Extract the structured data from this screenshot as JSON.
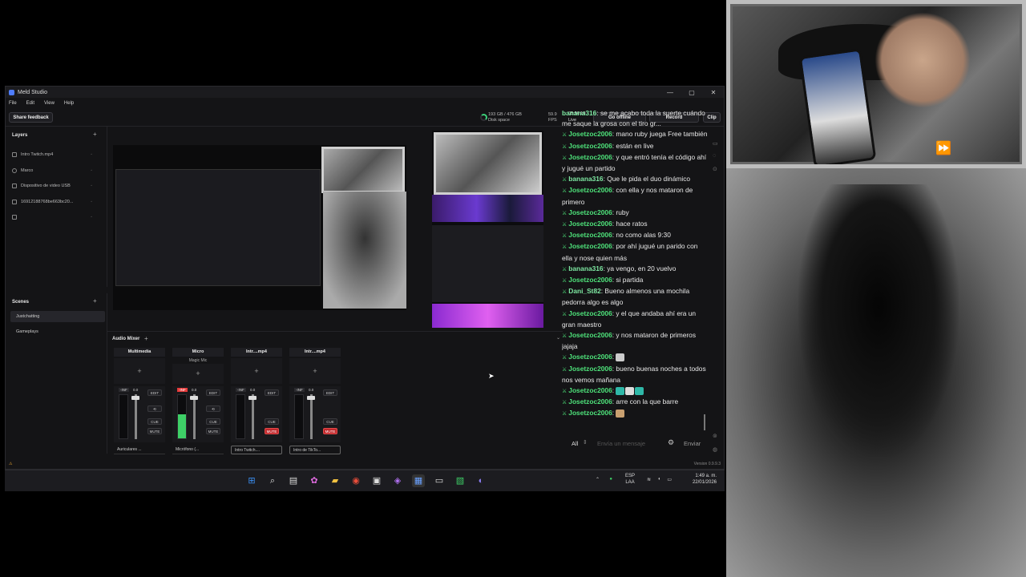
{
  "app": {
    "title": "Meld Studio",
    "menu": [
      "File",
      "Edit",
      "View",
      "Help"
    ],
    "share_feedback": "Share feedback",
    "disk": {
      "line1": "193 GB / 476 GB",
      "line2": "Disk space"
    },
    "fps": {
      "value": "59.9",
      "label": "FPS"
    },
    "live": {
      "time": "05:56:10",
      "label": "Live"
    },
    "go_offline": "Go offline",
    "record": "Record",
    "clip": "Clip",
    "window_controls": [
      "—",
      "▢",
      "✕"
    ]
  },
  "layers": {
    "title": "Layers",
    "items": [
      {
        "label": "Intro Twitch.mp4"
      },
      {
        "label": "Marco"
      },
      {
        "label": "Dispositivo de video USB"
      },
      {
        "label": "16912188768be663bc20..."
      },
      {
        "label": ""
      }
    ]
  },
  "scenes": {
    "title": "Scenes",
    "items": [
      {
        "label": "Justchatting",
        "active": true
      },
      {
        "label": "Gameplays",
        "active": false
      }
    ]
  },
  "mixer": {
    "title": "Audio Mixer",
    "strips": [
      {
        "name": "Multimedia",
        "sub": "",
        "db": "-INF",
        "db2": "0.0",
        "level": 0.0,
        "device": "Auriculares ...",
        "mute_red": false
      },
      {
        "name": "Micro",
        "sub": "Magic Mic",
        "db": "-INF",
        "db2": "0.0",
        "level": 0.55,
        "device": "Micrófono (...",
        "mute_red": false
      },
      {
        "name": "Intr....mp4",
        "sub": "",
        "db": "-INF",
        "db2": "0.0",
        "level": 0.0,
        "device": "Intro Twitch....",
        "mute_red": true
      },
      {
        "name": "Intr....mp4",
        "sub": "",
        "db": "-INF",
        "db2": "0.0",
        "level": 0.0,
        "device": "Intro de TikTo...",
        "mute_red": true
      }
    ],
    "buttons": {
      "edit": "EDIT",
      "cue": "CUE",
      "mute": "MUTE"
    }
  },
  "chat": {
    "messages": [
      {
        "user": "banana316",
        "text": ": se me acabo toda la suerte cuándo me saque la grosa con el tiro gr..."
      },
      {
        "user": "Josetzoc2006",
        "text": ": mano ruby juega Free también"
      },
      {
        "user": "Josetzoc2006",
        "text": ": están en live"
      },
      {
        "user": "Josetzoc2006",
        "text": ": y que entró tenía el código ahí y jugué un partido"
      },
      {
        "user": "banana316",
        "text": ": Que le pida el duo dinámico"
      },
      {
        "user": "Josetzoc2006",
        "text": ": con ella y nos mataron de primero"
      },
      {
        "user": "Josetzoc2006",
        "text": ": ruby"
      },
      {
        "user": "Josetzoc2006",
        "text": ": hace ratos"
      },
      {
        "user": "Josetzoc2006",
        "text": ": no como alas 9:30"
      },
      {
        "user": "Josetzoc2006",
        "text": ": por ahí jugué un parido con ella y nose quien más"
      },
      {
        "user": "banana316",
        "text": ": ya vengo, en 20 vuelvo"
      },
      {
        "user": "Josetzoc2006",
        "text": ": si partida"
      },
      {
        "user": "Dani_St82",
        "text": ": Bueno almenos una mochila pedorra algo es algo"
      },
      {
        "user": "Josetzoc2006",
        "text": ": y el que andaba ahí era un gran maestro"
      },
      {
        "user": "Josetzoc2006",
        "text": ": y nos mataron de primeros jajaja"
      },
      {
        "user": "Josetzoc2006",
        "text": ":"
      },
      {
        "user": "Josetzoc2006",
        "text": ": bueno buenas noches a todos nos vemos mañana"
      },
      {
        "user": "Josetzoc2006",
        "text": ":"
      },
      {
        "user": "Josetzoc2006",
        "text": ": arre con la que barre"
      },
      {
        "user": "Josetzoc2006",
        "text": ":"
      }
    ],
    "filter": "All",
    "input_placeholder": "Envía un mensaje",
    "send": "Enviar"
  },
  "status": {
    "version": "Version 0.9.9.3"
  },
  "taskbar": {
    "lang1": "ESP",
    "lang2": "LAA",
    "time": "1:49 a. m.",
    "date": "22/01/2026"
  },
  "colors": {
    "accent_green": "#4ee27a",
    "mute_red": "#c0292d",
    "app_bg": "#141416"
  }
}
